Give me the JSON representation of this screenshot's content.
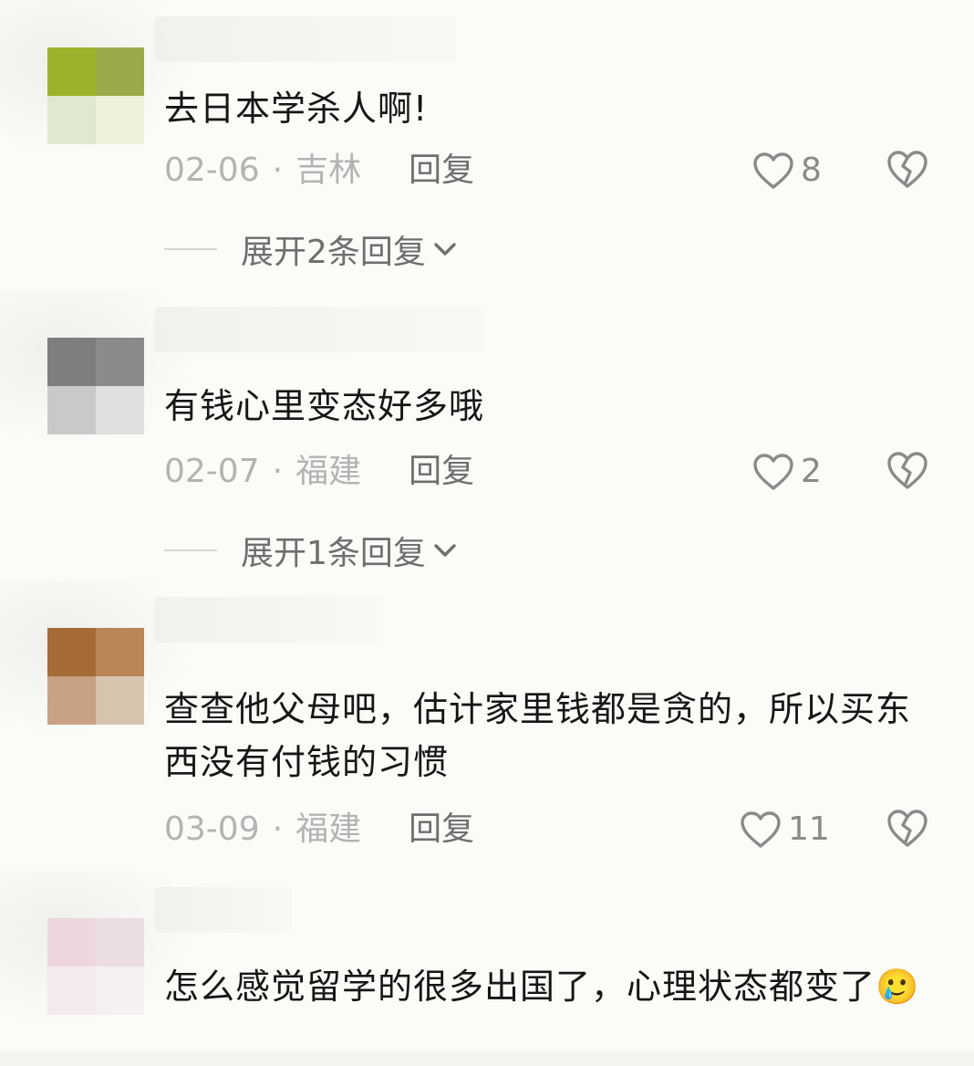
{
  "comments": [
    {
      "text": "去日本学杀人啊!",
      "date": "02-06",
      "separator": "·",
      "location": "吉林",
      "reply_label": "回复",
      "likes": "8",
      "expand_label": "展开2条回复"
    },
    {
      "text": "有钱心里变态好多哦",
      "date": "02-07",
      "separator": "·",
      "location": "福建",
      "reply_label": "回复",
      "likes": "2",
      "expand_label": "展开1条回复"
    },
    {
      "text": "查查他父母吧，估计家里钱都是贪的，所以买东西没有付钱的习惯",
      "date": "03-09",
      "separator": "·",
      "location": "福建",
      "reply_label": "回复",
      "likes": "11"
    },
    {
      "text": "怎么感觉留学的很多出国了，心理状态都变了🥲"
    }
  ],
  "colors": {
    "background": "#fbfbf8",
    "text": "#161616",
    "meta": "#b3b3b3",
    "action": "#6f6f6f",
    "icon": "#8a8a8a"
  },
  "icons": [
    "heart-outline-icon",
    "broken-heart-icon",
    "chevron-down-icon",
    "sweat-smile-emoji"
  ]
}
